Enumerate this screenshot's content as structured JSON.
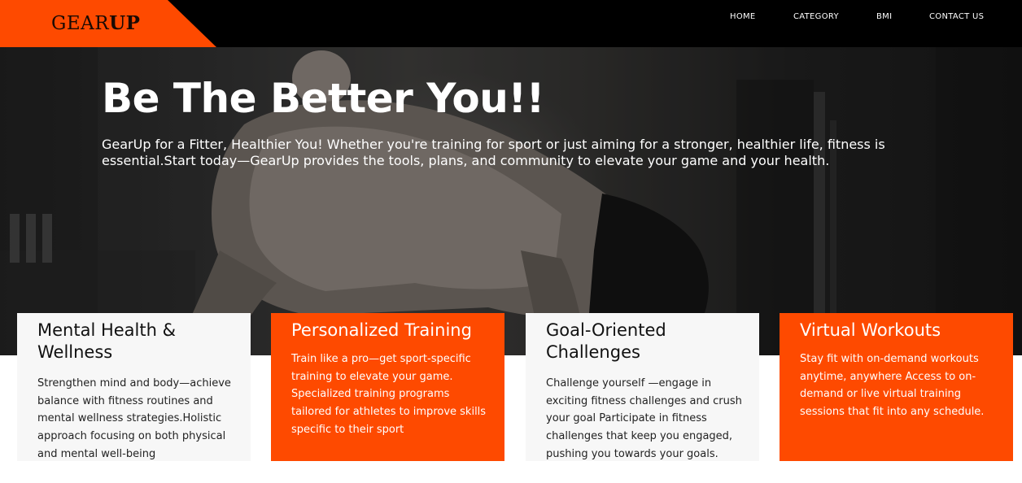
{
  "brand": {
    "logo_light": "GEAR",
    "logo_bold": "UP",
    "accent_color": "#fe4a00",
    "header_bg": "#000000"
  },
  "nav": {
    "items": [
      {
        "label": "HOME"
      },
      {
        "label": "CATEGORY"
      },
      {
        "label": "BMI"
      },
      {
        "label": "CONTACT US"
      }
    ]
  },
  "hero": {
    "title": "Be The Better You!!",
    "subtitle": "GearUp for a Fitter, Healthier You! Whether you're training for sport or just aiming for a stronger, healthier life, fitness is essential.Start today—GearUp provides the tools, plans, and community to elevate your game and your health."
  },
  "cards": [
    {
      "title": "Mental Health & Wellness",
      "text": "Strengthen mind and body—achieve balance with fitness routines and mental wellness strategies.Holistic approach focusing on both physical and mental well-being",
      "style": "light"
    },
    {
      "title": "Personalized Training",
      "text": "Train like a pro—get sport-specific training to elevate your game. Specialized training programs tailored for athletes to improve skills specific to their sport",
      "style": "orange"
    },
    {
      "title": "Goal-Oriented Challenges",
      "text": "Challenge yourself —engage in exciting fitness challenges and crush your goal Participate in fitness challenges that keep you engaged, pushing you towards your goals.",
      "style": "light"
    },
    {
      "title": "Virtual Workouts",
      "text": "Stay fit with on-demand workouts anytime, anywhere Access to on-demand or live virtual training sessions that fit into any schedule.",
      "style": "orange"
    }
  ]
}
